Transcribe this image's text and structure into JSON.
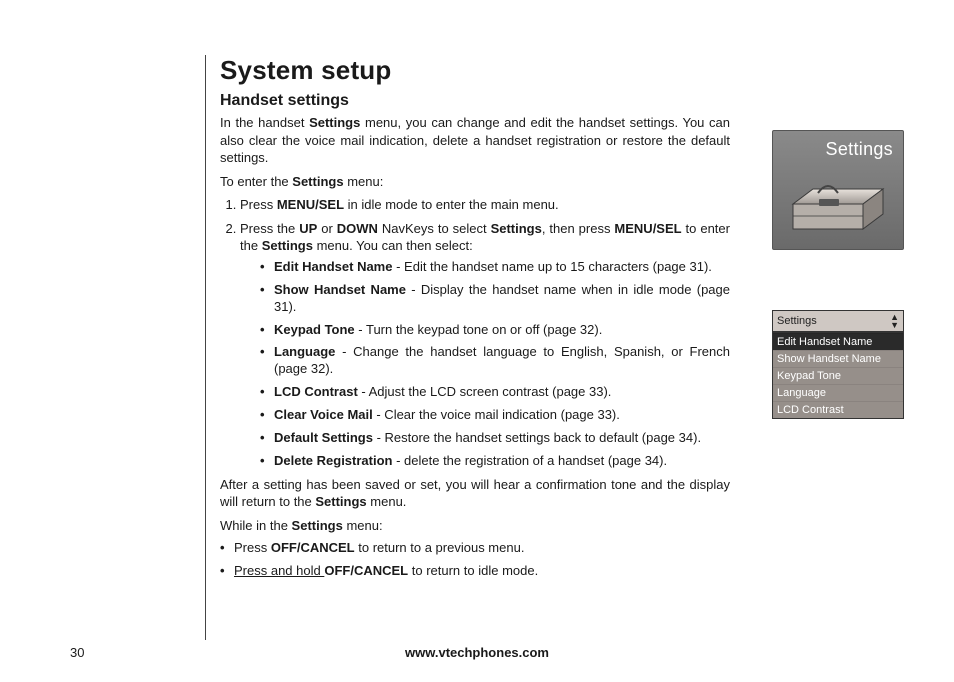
{
  "page": {
    "number": "30",
    "footer": "www.vtechphones.com"
  },
  "heading": "System setup",
  "section": "Handset settings",
  "intro_a": "In the handset ",
  "intro_settings": "Settings",
  "intro_b": " menu, you can change and edit the handset settings. You can also clear the voice mail indication, delete a handset registration or restore the default settings.",
  "enter_a": "To enter the ",
  "enter_b": " menu:",
  "step1_a": "Press ",
  "step1_menusel": "MENU/SEL",
  "step1_b": " in idle mode to enter the main menu.",
  "step2_a": "Press the ",
  "step2_up": "UP",
  "step2_b": " or ",
  "step2_down": "DOWN",
  "step2_c": " NavKeys to select ",
  "step2_settings": "Settings",
  "step2_d": ", then press ",
  "step2_menusel": "MENU/SEL",
  "step2_e": " to enter the ",
  "step2_settings2": "Settings",
  "step2_f": " menu. You can then select:",
  "features": [
    {
      "name": "Edit Handset Name",
      "desc": " - Edit the handset name up to 15 characters (page 31)."
    },
    {
      "name": "Show Handset Name",
      "desc": " - Display the handset name when in idle mode (page 31)."
    },
    {
      "name": "Keypad Tone",
      "desc": " - Turn the keypad tone on or off (page 32)."
    },
    {
      "name": "Language",
      "desc": " - Change the handset language to English, Spanish, or French (page 32)."
    },
    {
      "name": "LCD Contrast",
      "desc": " - Adjust the LCD screen contrast (page 33)."
    },
    {
      "name": "Clear Voice Mail",
      "desc": " - Clear the voice mail indication (page 33)."
    },
    {
      "name": "Default Settings",
      "desc": " - Restore the handset settings back to default (page 34)."
    },
    {
      "name": "Delete Registration",
      "desc": " - delete the registration of a handset (page 34)."
    }
  ],
  "after_a": "After a setting has been saved or set, you will hear a confirmation tone and the display will return to the ",
  "after_settings": "Settings",
  "after_b": " menu.",
  "while_a": "While in the ",
  "while_settings": "Settings",
  "while_b": " menu:",
  "bul1_a": "Press ",
  "bul1_off": "OFF/CANCEL",
  "bul1_b": " to return to a previous menu.",
  "bul2_a": "Press and hold ",
  "bul2_off": "OFF/CANCEL",
  "bul2_b": " to return to idle mode.",
  "toolbox": {
    "title": "Settings"
  },
  "lcd": {
    "header": "Settings",
    "items": [
      "Edit Handset Name",
      "Show Handset Name",
      "Keypad Tone",
      "Language",
      "LCD Contrast"
    ]
  }
}
